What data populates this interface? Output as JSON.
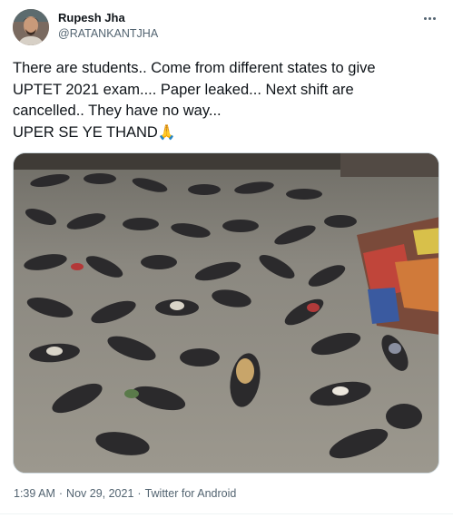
{
  "author": {
    "display_name": "Rupesh Jha",
    "handle": "@RATANKANTJHA"
  },
  "tweet": {
    "lines": [
      "There are students.. Come from different states to give",
      "UPTET 2021 exam.... Paper leaked... Next shift are",
      "cancelled.. They have no way...",
      "UPER SE YE THAND"
    ],
    "emoji": "🙏"
  },
  "meta": {
    "time": "1:39 AM",
    "date": "Nov 29, 2021",
    "source": "Twitter for Android",
    "separator": "·"
  },
  "icons": {
    "more": "more-horizontal-icon"
  }
}
